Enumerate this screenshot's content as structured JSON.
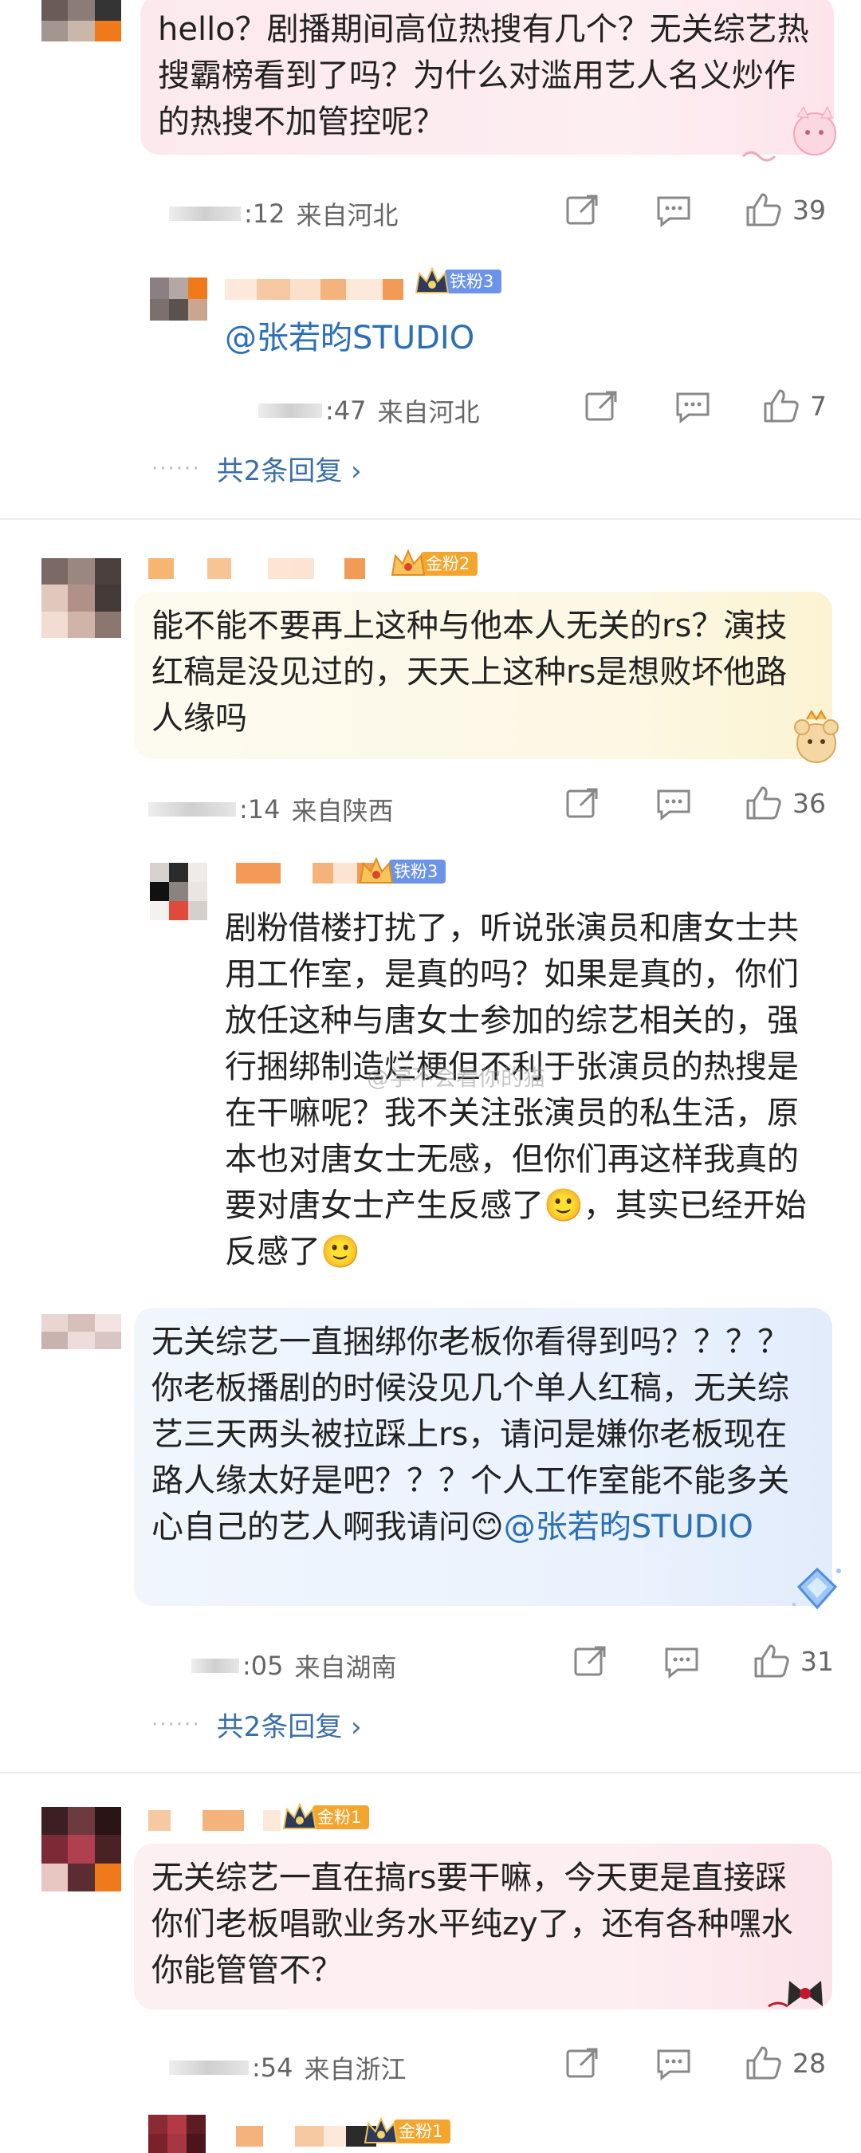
{
  "comments": [
    {
      "text": "hello？剧播期间高位热搜有几个？无关综艺热搜霸榜看到了吗？为什么对滥用艺人名义炒作的热搜不加管控呢？",
      "time": ":12",
      "location": "来自河北",
      "likes": "39",
      "reply": {
        "badge": "铁粉3",
        "text": "@张若昀STUDIO",
        "time": ":47",
        "location": "来自河北",
        "likes": "7"
      },
      "more_replies": "共2条回复 ›"
    },
    {
      "badge": "金粉2",
      "text": "能不能不要再上这种与他本人无关的rs？演技红稿是没见过的，天天上这种rs是想败坏他路人缘吗",
      "time": ":14",
      "location": "来自陕西",
      "likes": "36",
      "reply": {
        "badge": "铁粉3",
        "text": "剧粉借楼打扰了，听说张演员和唐女士共用工作室，是真的吗？如果是真的，你们放任这种与唐女士参加的综艺相关的，强行捆绑制造烂梗但不利于张演员的热搜是在干嘛呢？我不关注张演员的私生活，原本也对唐女士无感，但你们再这样我真的要对唐女士产生反感了🙂，其实已经开始反感了🙂"
      }
    },
    {
      "text_before": "无关综艺一直捆绑你老板你看得到吗？？？？你老板播剧的时候没见几个单人红稿，无关综艺三天两头被拉踩上rs，请问是嫌你老板现在路人缘太好是吧？？？个人工作室能不能多关心自己的艺人啊我请问😊",
      "mention": "@张若昀STUDIO",
      "time": ":05",
      "location": "来自湖南",
      "likes": "31",
      "more_replies": "共2条回复 ›"
    },
    {
      "badge": "金粉1",
      "text": "无关综艺一直在搞rs要干嘛，今天更是直接踩你们老板唱歌业务水平纯zy了，还有各种嘿水你能管管不？",
      "time": ":54",
      "location": "来自浙江",
      "likes": "28"
    },
    {
      "badge": "金粉1"
    }
  ],
  "watermark": "@学不会看你的猫",
  "icons": {
    "share": "share-icon",
    "comment": "comment-icon",
    "like": "thumbs-up-icon",
    "crown": "crown-icon"
  },
  "colors": {
    "iron_badge": "#6b93e8",
    "gold_badge": "#f3a52e",
    "mention": "#2b6fb6",
    "pink_bubble": "#fdeef2",
    "yellow_bubble": "#fdf8e4",
    "blue_bubble": "#eaf2fd"
  }
}
